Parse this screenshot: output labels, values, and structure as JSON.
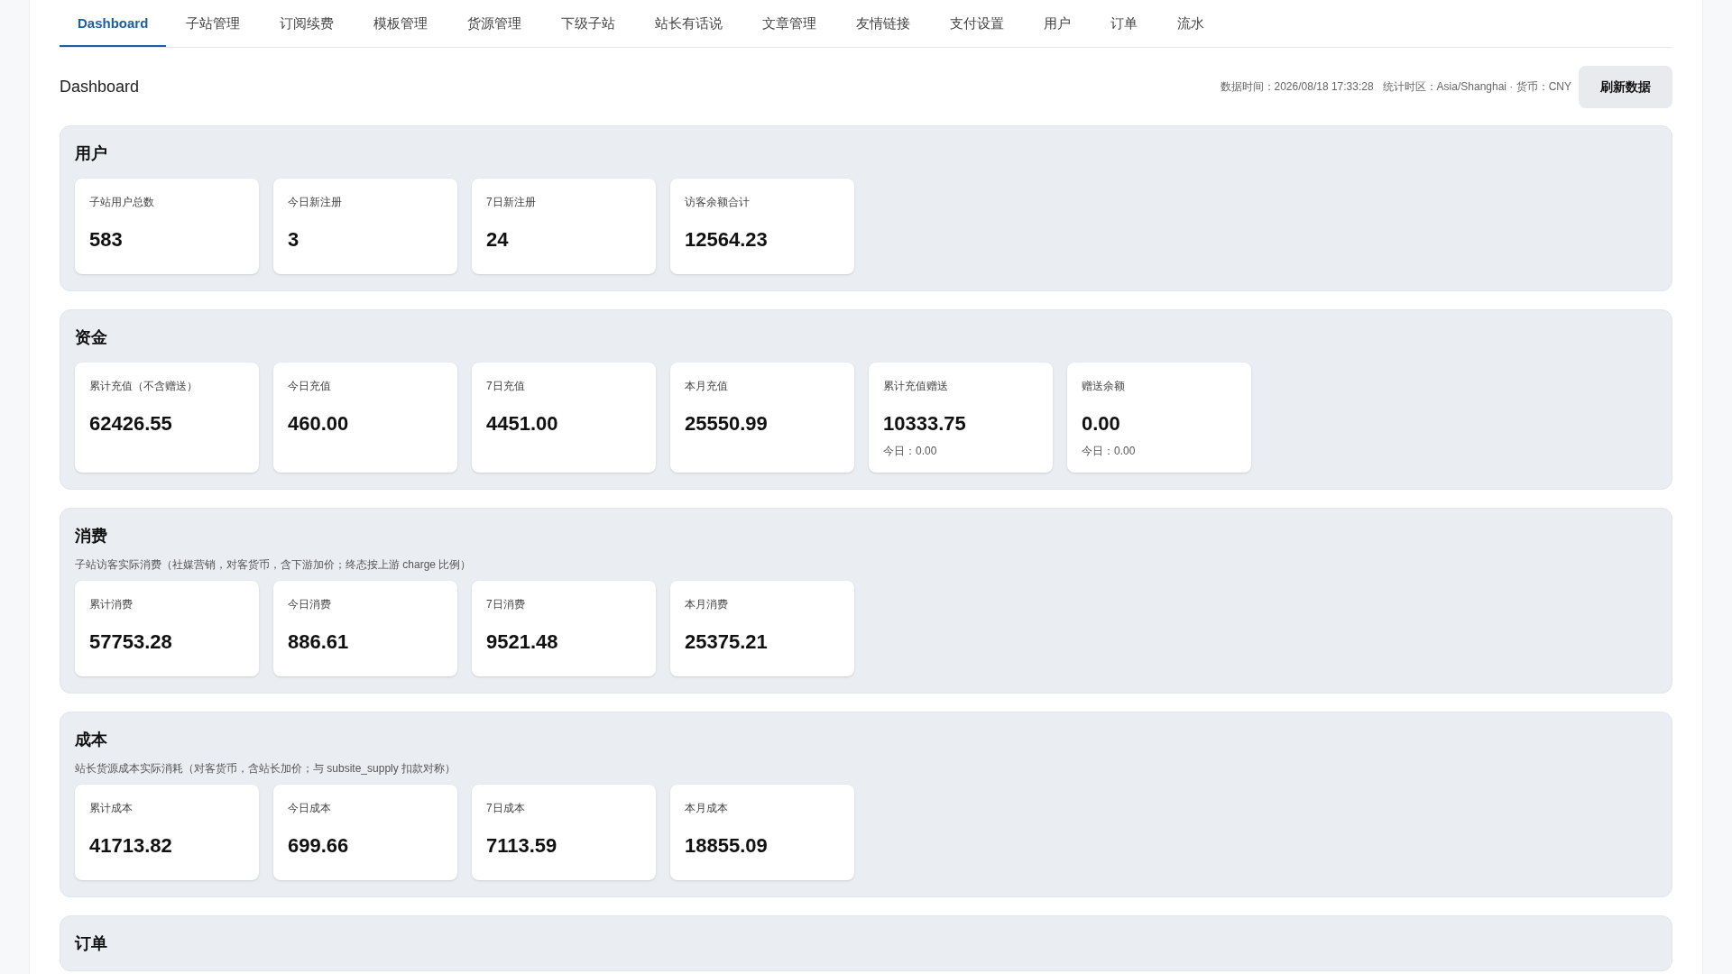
{
  "tabs": [
    {
      "label": "Dashboard",
      "selected": true
    },
    {
      "label": "子站管理",
      "selected": false
    },
    {
      "label": "订阅续费",
      "selected": false
    },
    {
      "label": "模板管理",
      "selected": false
    },
    {
      "label": "货源管理",
      "selected": false
    },
    {
      "label": "下级子站",
      "selected": false
    },
    {
      "label": "站长有话说",
      "selected": false
    },
    {
      "label": "文章管理",
      "selected": false
    },
    {
      "label": "友情链接",
      "selected": false
    },
    {
      "label": "支付设置",
      "selected": false
    },
    {
      "label": "用户",
      "selected": false
    },
    {
      "label": "订单",
      "selected": false
    },
    {
      "label": "流水",
      "selected": false
    }
  ],
  "header": {
    "title": "Dashboard",
    "meta": "数据时间：2026/08/18 17:33:28   统计时区：Asia/Shanghai · 货币：CNY",
    "refresh_button": "刷新数据"
  },
  "sections": [
    {
      "title": "用户",
      "cards": [
        {
          "label": "子站用户总数",
          "value": "583"
        },
        {
          "label": "今日新注册",
          "value": "3"
        },
        {
          "label": "7日新注册",
          "value": "24"
        },
        {
          "label": "访客余额合计",
          "value": "12564.23"
        }
      ]
    },
    {
      "title": "资金",
      "cards": [
        {
          "label": "累计充值（不含赠送）",
          "value": "62426.55"
        },
        {
          "label": "今日充值",
          "value": "460.00"
        },
        {
          "label": "7日充值",
          "value": "4451.00"
        },
        {
          "label": "本月充值",
          "value": "25550.99"
        },
        {
          "label": "累计充值赠送",
          "value": "10333.75",
          "note": "今日：0.00"
        },
        {
          "label": "赠送余额",
          "value": "0.00",
          "note": "今日：0.00"
        }
      ]
    },
    {
      "title": "消费",
      "description": "子站访客实际消费（社媒营销，对客货币，含下游加价；终态按上游 charge 比例）",
      "cards": [
        {
          "label": "累计消费",
          "value": "57753.28"
        },
        {
          "label": "今日消费",
          "value": "886.61"
        },
        {
          "label": "7日消费",
          "value": "9521.48"
        },
        {
          "label": "本月消费",
          "value": "25375.21"
        }
      ]
    },
    {
      "title": "成本",
      "description": "站长货源成本实际消耗（对客货币，含站长加价；与 subsite_supply 扣款对称）",
      "cards": [
        {
          "label": "累计成本",
          "value": "41713.82"
        },
        {
          "label": "今日成本",
          "value": "699.66"
        },
        {
          "label": "7日成本",
          "value": "7113.59"
        },
        {
          "label": "本月成本",
          "value": "18855.09"
        }
      ]
    },
    {
      "title": "订单"
    }
  ]
}
